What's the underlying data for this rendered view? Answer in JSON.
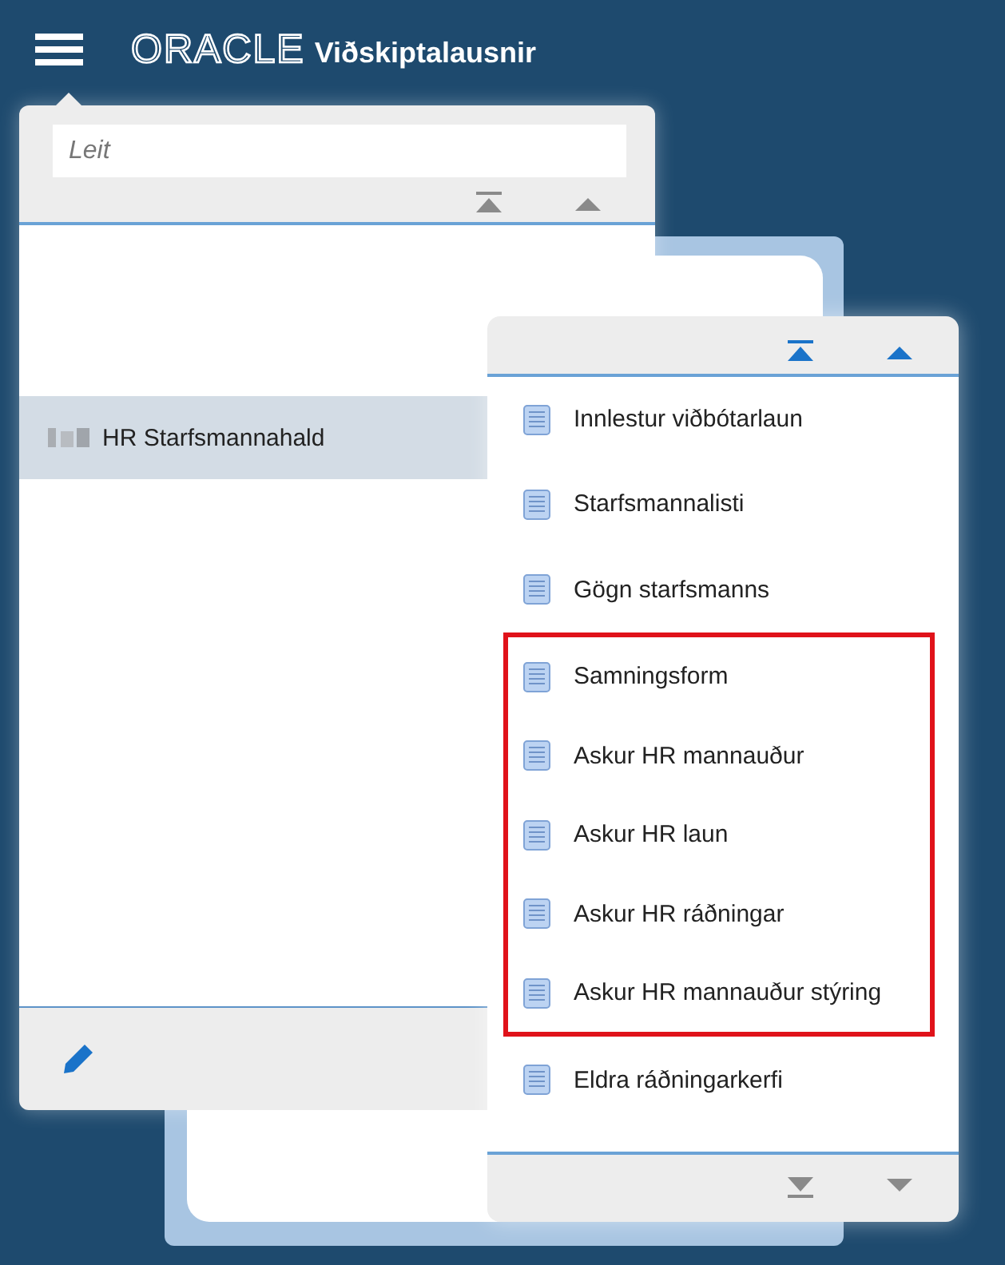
{
  "header": {
    "logo": "ORACLE",
    "title": "Viðskiptalausnir"
  },
  "navigator": {
    "search": {
      "placeholder": "Leit"
    },
    "top_scroll": [
      {
        "kind": "first",
        "disabled": true
      },
      {
        "kind": "prev",
        "disabled": true
      }
    ],
    "items": [
      {
        "label": "HR Starfsmannahald",
        "selected": true
      }
    ]
  },
  "submenu": {
    "top_scroll": [
      {
        "kind": "first",
        "disabled": false
      },
      {
        "kind": "prev",
        "disabled": false
      }
    ],
    "items": [
      {
        "label": "Innlestur viðbótarlaun",
        "highlighted": false
      },
      {
        "label": "Starfsmannalisti",
        "highlighted": false
      },
      {
        "label": "Gögn starfsmanns",
        "highlighted": false
      },
      {
        "label": "Samningsform",
        "highlighted": true
      },
      {
        "label": "Askur HR mannauður",
        "highlighted": true
      },
      {
        "label": "Askur HR laun",
        "highlighted": true
      },
      {
        "label": "Askur HR ráðningar",
        "highlighted": true
      },
      {
        "label": "Askur HR mannauður stýring",
        "highlighted": true
      },
      {
        "label": "Eldra ráðningarkerfi",
        "highlighted": false
      }
    ],
    "bottom_scroll": [
      {
        "kind": "last",
        "disabled": true
      },
      {
        "kind": "next",
        "disabled": true
      }
    ]
  }
}
